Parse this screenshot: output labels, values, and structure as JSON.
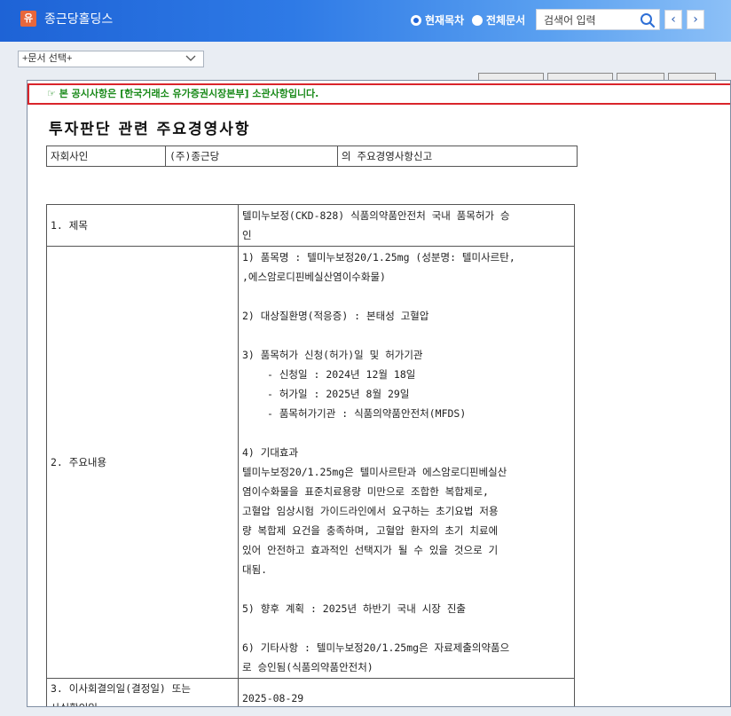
{
  "header": {
    "logo_char": "유",
    "company": "종근당홀딩스",
    "radio_current": "현재목차",
    "radio_all": "전체문서",
    "search_placeholder": "검색어 입력",
    "prev": "‹",
    "next": "›"
  },
  "doc_select": {
    "value": "+문서 선택+"
  },
  "notice": "☞ 본 공시사항은 [한국거래소 유가증권시장본부] 소관사항입니다.",
  "title": "투자판단 관련 주요경영사항",
  "info": {
    "c1": "자회사인",
    "c2": "(주)종근당",
    "c3": "의 주요경영사항신고"
  },
  "rows": {
    "r1_label": "1. 제목",
    "r1_value_l1": "텔미누보정(CKD-828) 식품의약품안전처 국내 품목허가 승",
    "r1_value_l2": "인",
    "r2_label": "2. 주요내용",
    "r2_lines": [
      "1) 품목명 : 텔미누보정20/1.25mg (성분명: 텔미사르탄,",
      ",에스암로디핀베실산염이수화물)",
      "",
      "2) 대상질환명(적응증) : 본태성 고혈압",
      "",
      "3) 품목허가 신청(허가)일 및 허가기관",
      "- 신청일 : 2024년 12월 18일",
      "- 허가일 : 2025년 8월 29일",
      "- 품목허가기관 : 식품의약품안전처(MFDS)",
      "",
      "4) 기대효과",
      "텔미누보정20/1.25mg은 텔미사르탄과 에스암로디핀베실산",
      "염이수화물을 표준치료용량 미만으로 조합한 복합제로,",
      "고혈압 임상시험 가이드라인에서 요구하는 초기요법 저용",
      "량 복합제 요건을 충족하며, 고혈압 환자의 초기 치료에",
      "있어 안전하고 효과적인 선택지가 될 수 있을 것으로 기",
      "대됨.",
      "",
      "5) 향후 계획 : 2025년 하반기 국내 시장 진출",
      "",
      "6) 기타사항 : 텔미누보정20/1.25mg은 자료제출의약품으",
      "로 승인됨(식품의약품안전처)"
    ],
    "r3_label_l1": "3. 이사회결의일(결정일) 또는",
    "r3_label_l2": "사실확인일",
    "r3_value": "2025-08-29"
  }
}
